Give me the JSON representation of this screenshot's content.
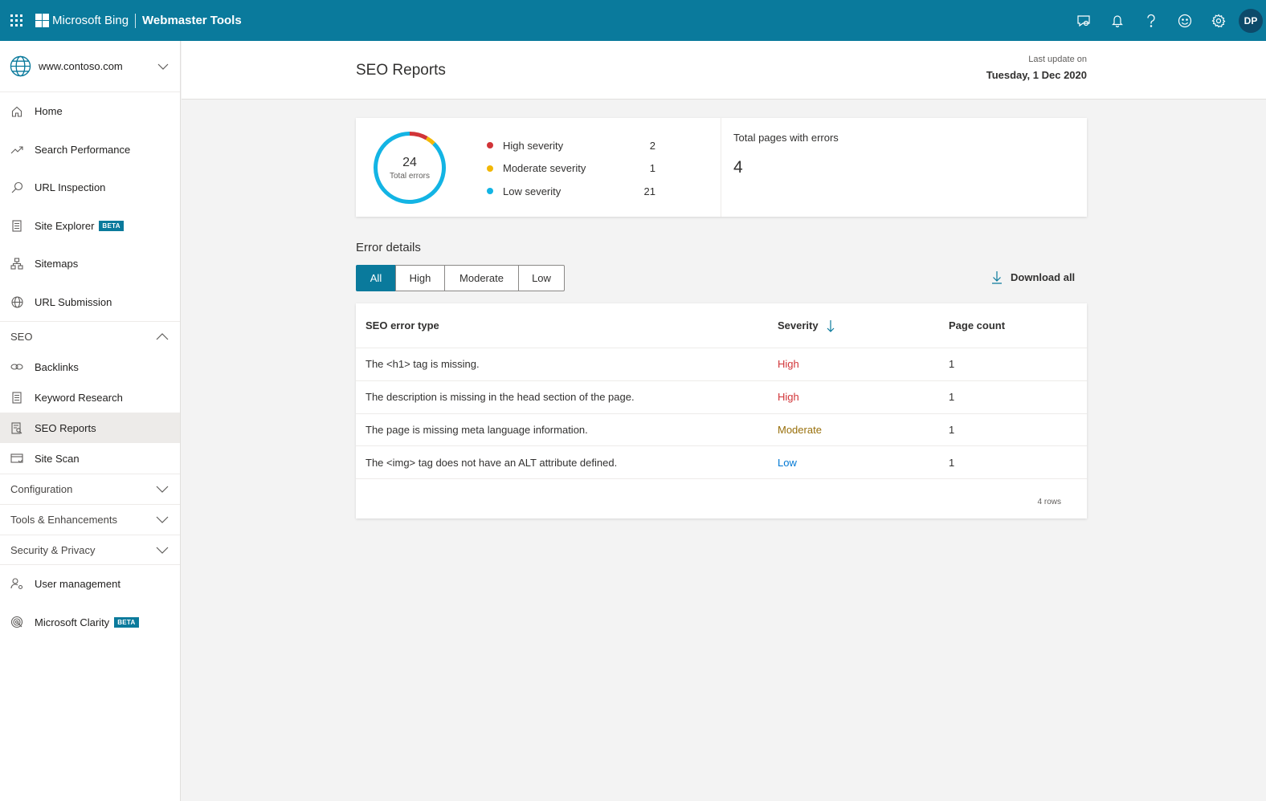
{
  "topbar": {
    "brand": "Microsoft Bing",
    "product": "Webmaster Tools",
    "icons": [
      "feedback-icon",
      "bell-icon",
      "help-icon",
      "smiley-icon",
      "gear-icon"
    ],
    "avatar_initials": "DP"
  },
  "sidebar": {
    "site": "www.contoso.com",
    "items": [
      {
        "label": "Home",
        "icon": "home-icon"
      },
      {
        "label": "Search Performance",
        "icon": "trend-icon"
      },
      {
        "label": "URL Inspection",
        "icon": "search-icon"
      },
      {
        "label": "Site Explorer",
        "icon": "document-icon",
        "badge": "BETA"
      },
      {
        "label": "Sitemaps",
        "icon": "sitemap-icon"
      },
      {
        "label": "URL Submission",
        "icon": "globe-icon"
      }
    ],
    "seo_section": "SEO",
    "seo_items": [
      {
        "label": "Backlinks",
        "icon": "link-icon"
      },
      {
        "label": "Keyword Research",
        "icon": "document-icon"
      },
      {
        "label": "SEO Reports",
        "icon": "report-icon"
      },
      {
        "label": "Site Scan",
        "icon": "scan-icon"
      }
    ],
    "sections": [
      "Configuration",
      "Tools & Enhancements",
      "Security & Privacy"
    ],
    "bottom_items": [
      {
        "label": "User management",
        "icon": "user-icon"
      },
      {
        "label": "Microsoft Clarity",
        "icon": "clarity-icon",
        "badge": "BETA"
      }
    ]
  },
  "header": {
    "title": "SEO Reports",
    "last_update_label": "Last update on",
    "last_update_value": "Tuesday, 1 Dec 2020"
  },
  "summary": {
    "total_errors": "24",
    "total_errors_label": "Total errors",
    "legend": [
      {
        "label": "High severity",
        "value": "2",
        "color": "#d13438"
      },
      {
        "label": "Moderate severity",
        "value": "1",
        "color": "#f2b705"
      },
      {
        "label": "Low severity",
        "value": "21",
        "color": "#13b4e4"
      }
    ],
    "pages_label": "Total pages with errors",
    "pages_value": "4"
  },
  "details": {
    "title": "Error details",
    "filters": [
      "All",
      "High",
      "Moderate",
      "Low"
    ],
    "active_filter": "All",
    "download_label": "Download all",
    "columns": [
      "SEO error type",
      "Severity",
      "Page count"
    ],
    "rows": [
      {
        "type": "The <h1> tag is missing.",
        "severity": "High",
        "count": "1"
      },
      {
        "type": "The description is missing in the head section of the page.",
        "severity": "High",
        "count": "1"
      },
      {
        "type": "The page is missing meta language information.",
        "severity": "Moderate",
        "count": "1"
      },
      {
        "type": "The <img> tag does not have an ALT attribute defined.",
        "severity": "Low",
        "count": "1"
      }
    ],
    "rows_count": "4 rows"
  },
  "colors": {
    "brand": "#0a7a9c",
    "high": "#d13438",
    "moderate": "#f2b705",
    "low": "#13b4e4"
  }
}
